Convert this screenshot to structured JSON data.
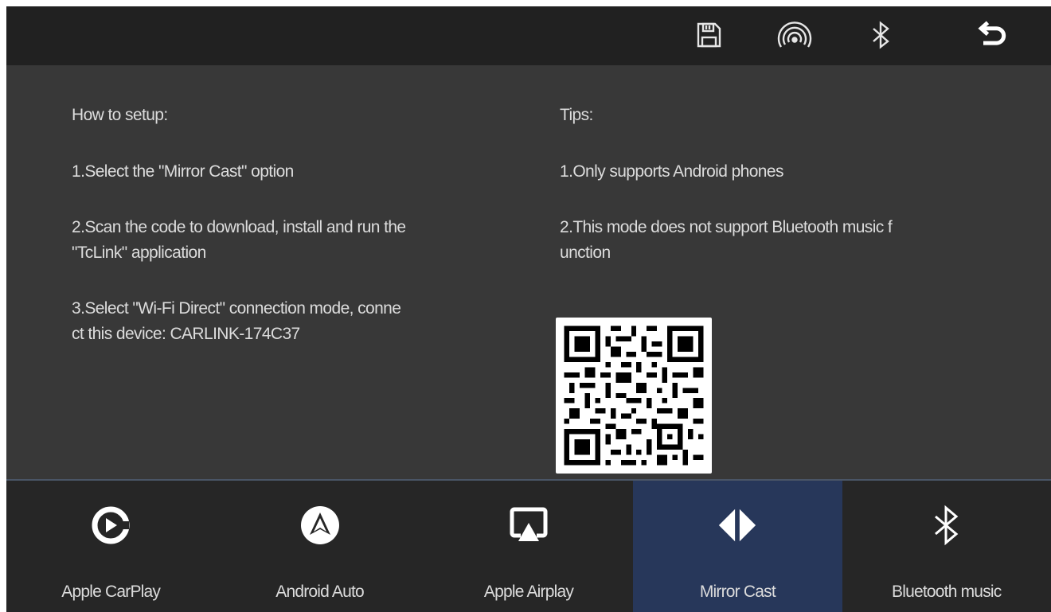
{
  "topbar": {
    "icons": [
      "save-icon",
      "wifi-signal-icon",
      "bluetooth-icon",
      "back-icon"
    ]
  },
  "setup": {
    "heading": "How to setup:",
    "steps": [
      "1.Select the \"Mirror Cast\" option",
      "2.Scan the code to download, install and run the\n \"TcLink\" application",
      "3.Select \"Wi-Fi Direct\" connection mode, conne\nct this device: CARLINK-174C37"
    ]
  },
  "tips": {
    "heading": "Tips:",
    "items": [
      "1.Only supports Android phones",
      "2.This mode does not support Bluetooth music f\nunction"
    ]
  },
  "tabs": [
    {
      "label": "Apple CarPlay",
      "icon": "carplay-icon",
      "active": false
    },
    {
      "label": "Android Auto",
      "icon": "android-auto-icon",
      "active": false
    },
    {
      "label": "Apple Airplay",
      "icon": "airplay-icon",
      "active": false
    },
    {
      "label": "Mirror Cast",
      "icon": "mirror-cast-icon",
      "active": true
    },
    {
      "label": "Bluetooth music",
      "icon": "bluetooth-music-icon",
      "active": false
    }
  ],
  "colors": {
    "background": "#383838",
    "topbar": "#212121",
    "bottombar": "#262626",
    "active_tab": "#27375a",
    "text": "#dcdcdc"
  }
}
